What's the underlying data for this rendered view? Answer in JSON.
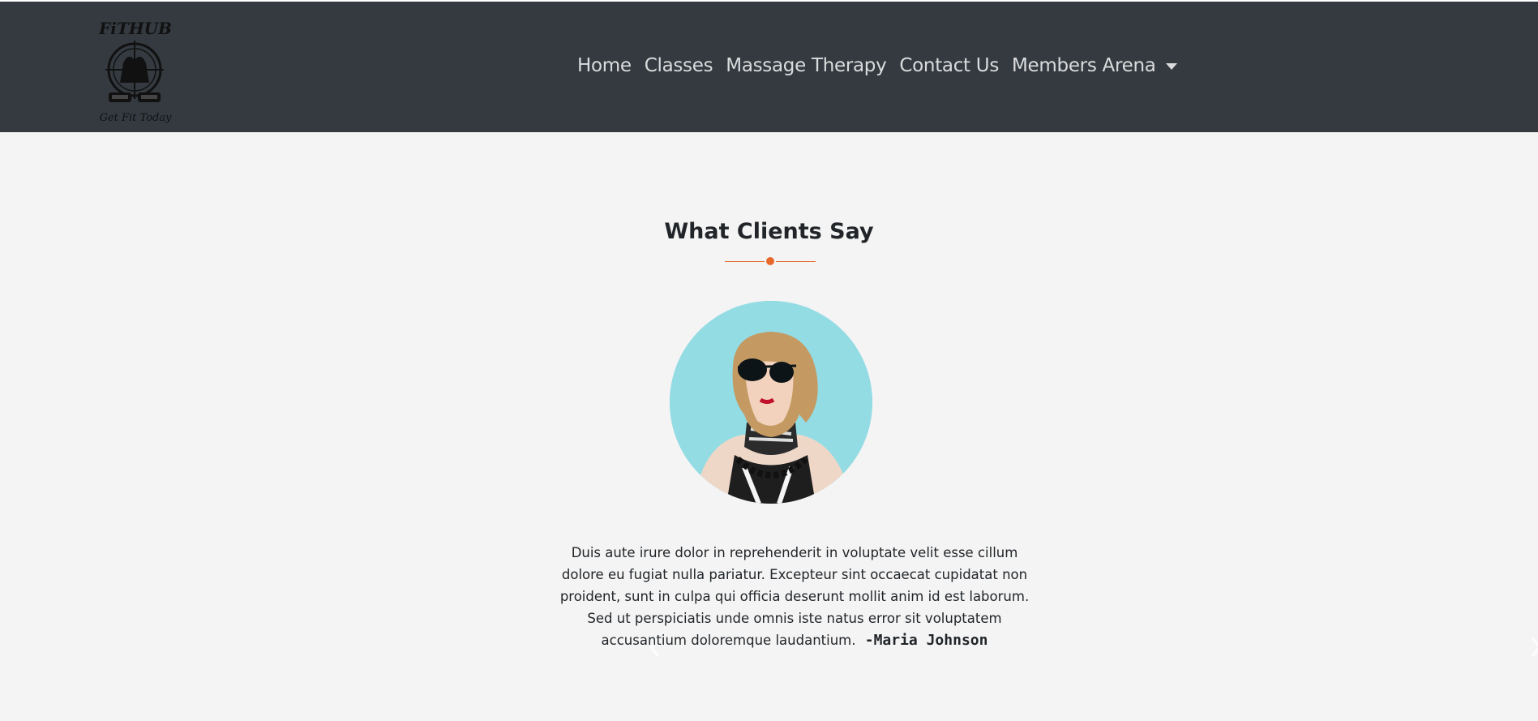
{
  "brand": {
    "name": "FiTHUB",
    "tagline": "Get Fit Today"
  },
  "nav": {
    "items": [
      {
        "label": "Home"
      },
      {
        "label": "Classes"
      },
      {
        "label": "Massage Therapy"
      },
      {
        "label": "Contact Us"
      }
    ],
    "dropdown": {
      "label": "Members Arena"
    }
  },
  "testimonials": {
    "title": "What Clients Say",
    "accent_color": "#e9692c",
    "quote": "Duis aute irure dolor in reprehenderit in voluptate velit esse cillum dolore eu fugiat nulla pariatur. Excepteur sint occaecat cupidatat non proident, sunt in culpa qui officia deserunt mollit anim id est laborum. Sed ut perspiciatis unde omnis iste natus error sit voluptatem accusantium doloremque laudantium.",
    "author": "-Maria Johnson",
    "controls": {
      "prev_icon": "chevron-left-icon",
      "next_icon": "chevron-right-icon"
    }
  }
}
